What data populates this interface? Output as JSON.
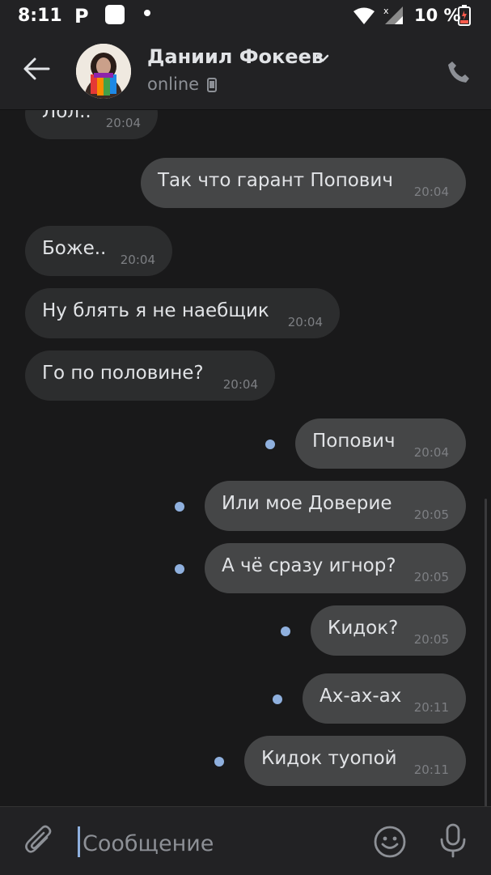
{
  "status_bar": {
    "time": "8:11",
    "icons": [
      "parking-p-icon",
      "mi-app-icon",
      "notification-dot-icon",
      "wifi-icon",
      "signal-icon",
      "battery-low-icon"
    ],
    "battery_text": "10 %"
  },
  "header": {
    "contact_name": "Даниил Фокеев",
    "status": "online",
    "icons": [
      "back-arrow-icon",
      "chevron-down-icon",
      "mobile-device-icon",
      "phone-icon"
    ]
  },
  "messages": [
    {
      "text": "Лол..",
      "time": "20:04",
      "direction": "in"
    },
    {
      "text": "Так что гарант Попович",
      "time": "20:04",
      "direction": "out"
    },
    {
      "text": "Боже..",
      "time": "20:04",
      "direction": "in"
    },
    {
      "text": "Ну блять я не наебщик",
      "time": "20:04",
      "direction": "in"
    },
    {
      "text": "Го по половине?",
      "time": "20:04",
      "direction": "in"
    },
    {
      "text": "Попович",
      "time": "20:04",
      "direction": "out",
      "unread": true
    },
    {
      "text": "Или мое Доверие",
      "time": "20:05",
      "direction": "out",
      "unread": true
    },
    {
      "text": "А чё сразу игнор?",
      "time": "20:05",
      "direction": "out",
      "unread": true
    },
    {
      "text": "Кидок?",
      "time": "20:05",
      "direction": "out",
      "unread": true
    },
    {
      "text": "Ах-ах-ах",
      "time": "20:11",
      "direction": "out",
      "unread": true
    },
    {
      "text": "Кидок туопой",
      "time": "20:11",
      "direction": "out",
      "unread": true
    }
  ],
  "composer": {
    "placeholder": "Сообщение",
    "icons": [
      "paperclip-icon",
      "emoji-icon",
      "microphone-icon"
    ]
  },
  "colors": {
    "background": "#19191a",
    "bar": "#222224",
    "incoming_bubble": "#2c2d2e",
    "outgoing_bubble": "#454647",
    "unread_dot": "#8fb0de",
    "text": "#e1e3e6",
    "secondary_text": "#8d9096"
  }
}
